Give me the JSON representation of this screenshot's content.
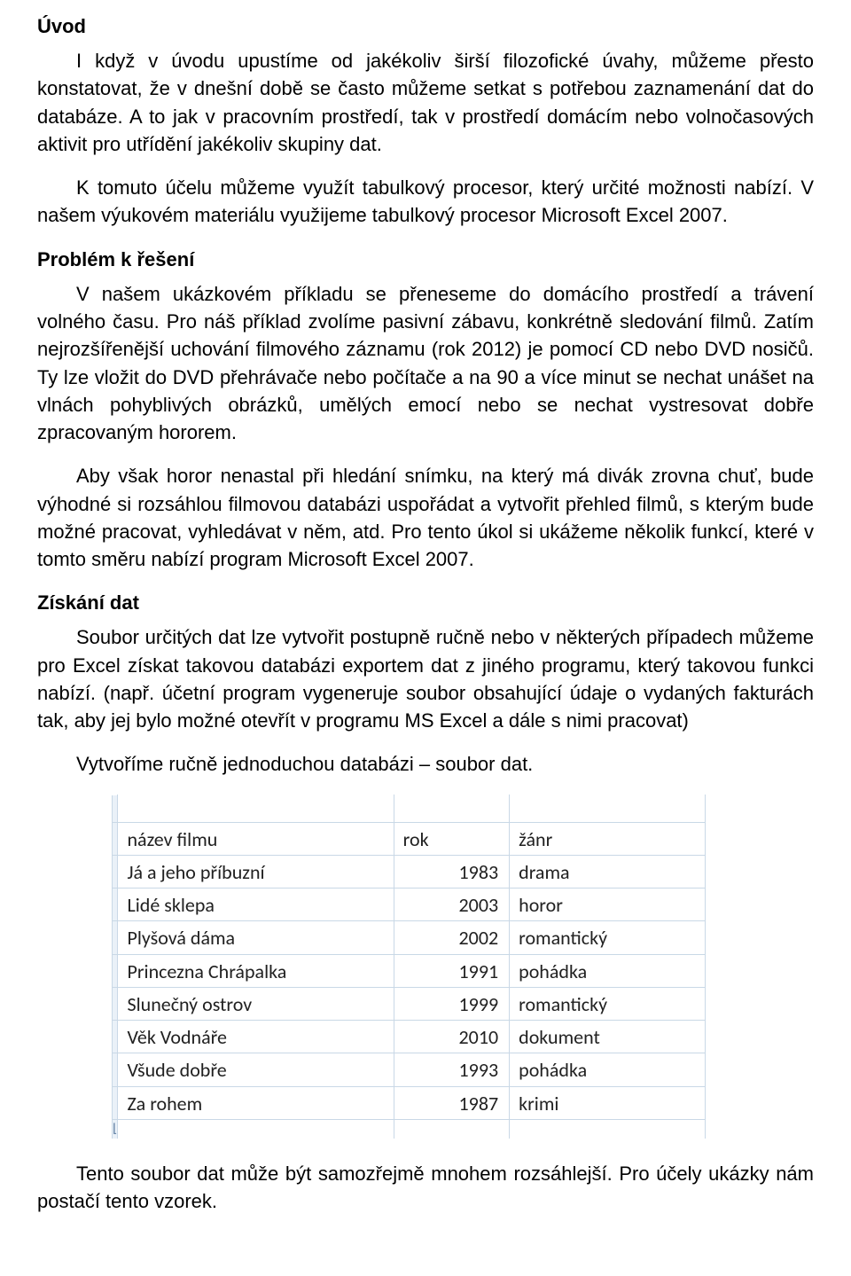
{
  "h1": "Úvod",
  "p1": "I když v úvodu upustíme od jakékoliv širší filozofické úvahy, můžeme přesto konstatovat, že v dnešní době se často můžeme setkat s potřebou zaznamenání dat do databáze. A to jak v pracovním prostředí, tak v prostředí domácím nebo volnočasových aktivit pro utřídění jakékoliv skupiny dat.",
  "p2": "K tomuto účelu můžeme využít tabulkový procesor, který určité možnosti nabízí. V našem výukovém materiálu využijeme tabulkový procesor Microsoft Excel 2007.",
  "h2": "Problém k řešení",
  "p3": "V našem ukázkovém příkladu se přeneseme do domácího prostředí a trávení volného času. Pro náš příklad zvolíme pasivní zábavu, konkrétně sledování filmů. Zatím nejrozšířenější uchování filmového záznamu (rok 2012) je pomocí CD nebo DVD nosičů. Ty lze vložit do DVD přehrávače nebo počítače a na 90 a více minut se nechat unášet na vlnách pohyblivých obrázků, umělých emocí nebo se nechat vystresovat dobře zpracovaným hororem.",
  "p4": "Aby však horor nenastal při hledání snímku, na který má divák zrovna chuť, bude výhodné si rozsáhlou filmovou databázi uspořádat a vytvořit přehled filmů, s kterým bude možné pracovat, vyhledávat v něm, atd. Pro tento úkol si ukážeme několik funkcí, které v tomto směru nabízí program Microsoft Excel 2007.",
  "h3": "Získání dat",
  "p5": "Soubor určitých dat lze vytvořit postupně ručně nebo v některých případech můžeme pro Excel získat takovou databázi exportem dat z jiného programu, který takovou funkci nabízí. (např. účetní program vygeneruje soubor obsahující údaje o vydaných fakturách tak, aby jej bylo možné otevřít v programu MS Excel a dále s nimi pracovat)",
  "p6": "Vytvoříme ručně jednoduchou databázi – soubor dat.",
  "p7": "Tento soubor dat může být samozřejmě mnohem rozsáhlejší. Pro účely ukázky nám postačí tento vzorek.",
  "headers": {
    "name": "název filmu",
    "year": "rok",
    "genre": "žánr"
  },
  "rows": [
    {
      "name": "Já a jeho příbuzní",
      "year": "1983",
      "genre": "drama"
    },
    {
      "name": "Lidé sklepa",
      "year": "2003",
      "genre": "horor"
    },
    {
      "name": "Plyšová dáma",
      "year": "2002",
      "genre": "romantický"
    },
    {
      "name": "Princezna Chrápalka",
      "year": "1991",
      "genre": "pohádka"
    },
    {
      "name": "Slunečný ostrov",
      "year": "1999",
      "genre": "romantický"
    },
    {
      "name": "Věk Vodnáře",
      "year": "2010",
      "genre": "dokument"
    },
    {
      "name": "Všude dobře",
      "year": "1993",
      "genre": "pohádka"
    },
    {
      "name": "Za rohem",
      "year": "1987",
      "genre": "krimi"
    }
  ]
}
